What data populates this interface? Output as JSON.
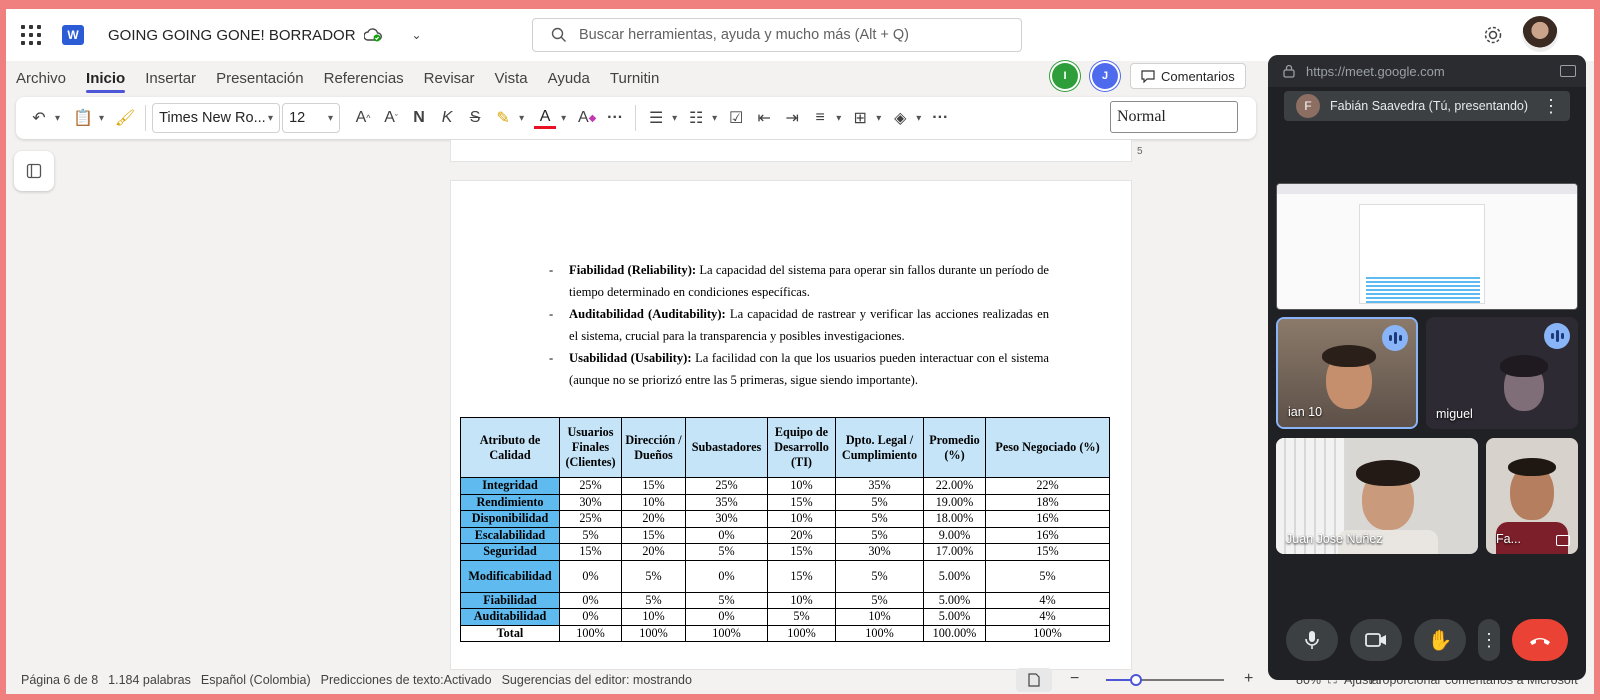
{
  "app": {
    "doc_title": "GOING GOING GONE! BORRADOR",
    "search_placeholder": "Buscar herramientas, ayuda y mucho más (Alt + Q)"
  },
  "ribbon": {
    "tabs": [
      "Archivo",
      "Inicio",
      "Insertar",
      "Presentación",
      "Referencias",
      "Revisar",
      "Vista",
      "Ayuda",
      "Turnitin"
    ],
    "active_tab": "Inicio",
    "presence": [
      {
        "initial": "I",
        "color": "#2e9e3a"
      },
      {
        "initial": "J",
        "color": "#4f6bed"
      }
    ],
    "comments_label": "Comentarios"
  },
  "toolbar": {
    "font_name": "Times New Ro...",
    "font_size": "12",
    "style_name": "Normal",
    "icons": [
      "undo-icon",
      "paste-icon",
      "format-painter-icon",
      "grow-font-icon",
      "shrink-font-icon",
      "bold-icon",
      "italic-icon",
      "strikethrough-icon",
      "highlight-icon",
      "font-color-icon",
      "clear-format-icon",
      "more-icon",
      "bullets-icon",
      "numbering-icon",
      "checklist-icon",
      "decrease-indent-icon",
      "increase-indent-icon",
      "align-icon",
      "borders-icon",
      "shading-icon",
      "more-icon"
    ]
  },
  "document": {
    "prev_page_number": "5",
    "bullets": [
      {
        "term": "Fiabilidad (Reliability):",
        "text": "La capacidad del sistema para operar sin fallos durante un período de tiempo determinado en condiciones específicas."
      },
      {
        "term": "Auditabilidad (Auditability):",
        "text": "La capacidad de rastrear y verificar las acciones realizadas en el sistema, crucial para la transparencia y posibles investigaciones."
      },
      {
        "term": "Usabilidad (Usability):",
        "text": "La facilidad con la que los usuarios pueden interactuar con el sistema (aunque no se priorizó entre las 5 primeras, sigue siendo importante)."
      }
    ],
    "table": {
      "headers": [
        "Atributo de Calidad",
        "Usuarios Finales (Clientes)",
        "Dirección / Dueños",
        "Subastadores",
        "Equipo de Desarrollo (TI)",
        "Dpto. Legal / Cumplimiento",
        "Promedio (%)",
        "Peso Negociado (%)"
      ],
      "rows": [
        [
          "Integridad",
          "25%",
          "15%",
          "25%",
          "10%",
          "35%",
          "22.00%",
          "22%"
        ],
        [
          "Rendimiento",
          "30%",
          "10%",
          "35%",
          "15%",
          "5%",
          "19.00%",
          "18%"
        ],
        [
          "Disponibilidad",
          "25%",
          "20%",
          "30%",
          "10%",
          "5%",
          "18.00%",
          "16%"
        ],
        [
          "Escalabilidad",
          "5%",
          "15%",
          "0%",
          "20%",
          "5%",
          "9.00%",
          "16%"
        ],
        [
          "Seguridad",
          "15%",
          "20%",
          "5%",
          "15%",
          "30%",
          "17.00%",
          "15%"
        ],
        [
          "Modificabilidad",
          "0%",
          "5%",
          "0%",
          "15%",
          "5%",
          "5.00%",
          "5%"
        ],
        [
          "Fiabilidad",
          "0%",
          "5%",
          "5%",
          "10%",
          "5%",
          "5.00%",
          "4%"
        ],
        [
          "Auditabilidad",
          "0%",
          "10%",
          "0%",
          "5%",
          "10%",
          "5.00%",
          "4%"
        ],
        [
          "Total",
          "100%",
          "100%",
          "100%",
          "100%",
          "100%",
          "100.00%",
          "100%"
        ]
      ]
    }
  },
  "statusbar": {
    "page": "Página 6 de 8",
    "words": "1.184 palabras",
    "language": "Español (Colombia)",
    "predictions": "Predicciones de texto:Activado",
    "suggestions": "Sugerencias del editor: mostrando",
    "zoom": "80%",
    "zoom_fraction": 0.2,
    "fit": "Ajustar",
    "feedback": "Proporcionar comentarios a Microsoft"
  },
  "meet": {
    "url": "https://meet.google.com",
    "presenter_initial": "F",
    "presenter_label": "Fabián Saavedra (Tú, presentando)",
    "participants": [
      "ian 10",
      "miguel",
      "Juan Jose Nuñez",
      "Fa..."
    ]
  },
  "colors": {
    "accent": "#4c56d6",
    "table_header": "#c5e4f7",
    "table_row_header": "#5fbbef",
    "frame": "#f08080",
    "end_call": "#ea4335"
  }
}
